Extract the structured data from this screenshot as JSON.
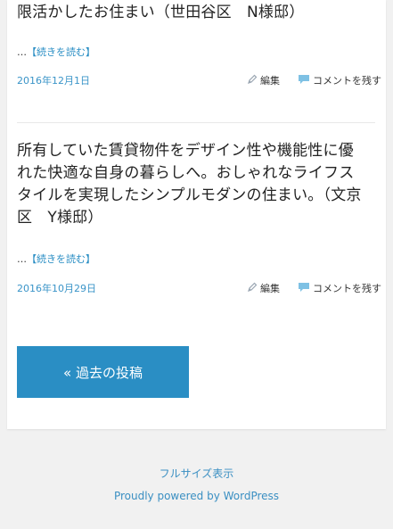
{
  "posts": [
    {
      "title": "限活かしたお住まい（世田谷区　N様邸）",
      "more_prefix": "…",
      "more_label": "【続きを読む】",
      "date": "2016年12月1日",
      "edit_label": "編集",
      "comment_label": "コメントを残す"
    },
    {
      "title": "所有していた賃貸物件をデザイン性や機能性に優れた快適な自身の暮らしへ。おしゃれなライフスタイルを実現したシンプルモダンの住まい。（文京区　Y様邸）",
      "more_prefix": "…",
      "more_label": "【続きを読む】",
      "date": "2016年10月29日",
      "edit_label": "編集",
      "comment_label": "コメントを残す"
    }
  ],
  "pagination": {
    "older_label": "« 過去の投稿"
  },
  "footer": {
    "fullsize_label": "フルサイズ表示",
    "powered_label": "Proudly powered by WordPress"
  },
  "icons": {
    "edit": "pencil-icon",
    "comment": "speech-bubble-icon"
  },
  "colors": {
    "accent": "#2a8ec4"
  }
}
